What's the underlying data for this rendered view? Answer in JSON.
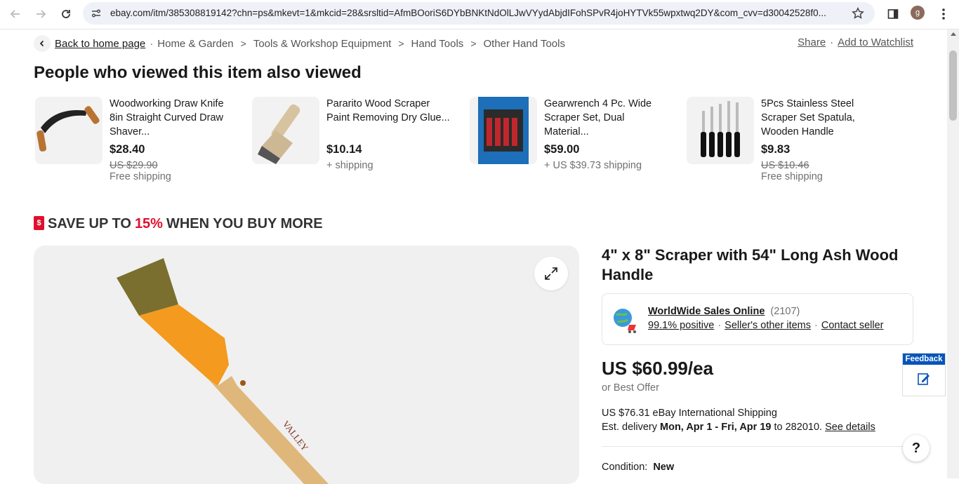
{
  "browser": {
    "url": "ebay.com/itm/385308819142?chn=ps&mkevt=1&mkcid=28&srsltid=AfmBOoriS6DYbBNKtNdOlLJwVYydAbjdIFohSPvR4joHYTVk55wpxtwq2DY&com_cvv=d30042528f0...",
    "profile_initial": "g"
  },
  "breadcrumb": {
    "back_label": "Back to home page",
    "items": [
      "Home & Garden",
      "Tools & Workshop Equipment",
      "Hand Tools",
      "Other Hand Tools"
    ]
  },
  "top_actions": {
    "share": "Share",
    "watchlist": "Add to Watchlist"
  },
  "section_title": "People who viewed this item also viewed",
  "recommendations": [
    {
      "title": "Woodworking Draw Knife 8in Straight Curved Draw Shaver...",
      "price": "$28.40",
      "original_price": "US $29.90",
      "shipping": "Free shipping"
    },
    {
      "title": "Pararito Wood Scraper Paint Removing Dry Glue...",
      "price": "$10.14",
      "original_price": "",
      "shipping": "+ shipping"
    },
    {
      "title": "Gearwrench 4 Pc. Wide Scraper Set, Dual Material...",
      "price": "$59.00",
      "original_price": "",
      "shipping": "+ US $39.73 shipping"
    },
    {
      "title": "5Pcs Stainless Steel Scraper Set Spatula, Wooden Handle",
      "price": "$9.83",
      "original_price": "US $10.46",
      "shipping": "Free shipping"
    }
  ],
  "save_banner": {
    "prefix": "SAVE UP TO",
    "percent": "15%",
    "suffix": "WHEN YOU BUY MORE",
    "icon_text": "$"
  },
  "item": {
    "title": "4\" x 8\" Scraper with 54\" Long Ash Wood Handle",
    "handle_brand": "VALLEY",
    "price": "US $60.99/ea",
    "best_offer": "or Best Offer",
    "shipping": "US $76.31 eBay International Shipping",
    "delivery_prefix": "Est. delivery",
    "delivery_dates": "Mon, Apr 1 - Fri, Apr 19",
    "delivery_to": "to 282010.",
    "see_details": "See details",
    "condition_label": "Condition:",
    "condition_value": "New"
  },
  "seller": {
    "name": "WorldWide Sales Online",
    "count": "(2107)",
    "positive": "99.1% positive",
    "other_items": "Seller's other items",
    "contact": "Contact seller"
  },
  "feedback_label": "Feedback",
  "help_label": "?",
  "colors": {
    "accent_red": "#e0102d",
    "feedback_blue": "#0654ba",
    "text": "#191919",
    "muted": "#707070"
  }
}
